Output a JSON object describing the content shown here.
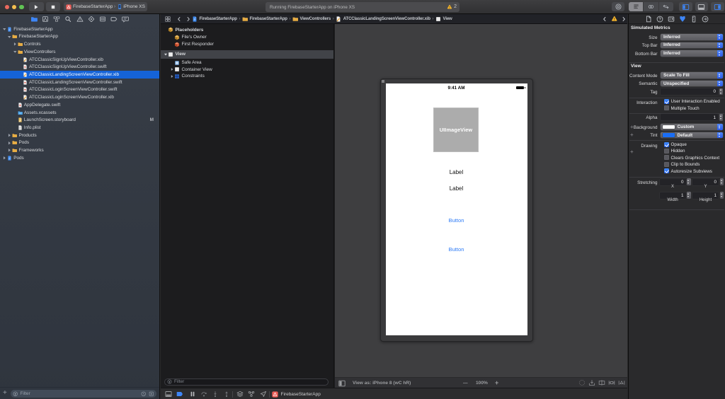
{
  "colors": {
    "accent_blue": "#1563d8",
    "checkbox_blue": "#2f6cf2",
    "folder_yellow": "#e0a63e",
    "warning_yellow": "#f5b52e",
    "button_blue": "#2e7bf6",
    "selected_text": "#ffffff"
  },
  "toolbar": {
    "window_buttons": [
      "close",
      "minimize",
      "zoom"
    ],
    "run_button": "run",
    "stop_button": "stop",
    "scheme": {
      "app_icon": "app-icon-red",
      "app": "FirebaseStarterApp",
      "chevron": "›",
      "device_icon": "iphone-icon",
      "device": "iPhone XS"
    },
    "activity": {
      "message": "Running FirebaseStarterApp on iPhone XS",
      "warning_icon": "warning-triangle-icon",
      "warning_count": "2"
    },
    "library_button": "library",
    "editor_modes": [
      "standard-editor",
      "assistant-editor",
      "version-editor"
    ],
    "panel_toggles": [
      "navigator-panel",
      "debug-panel",
      "inspector-panel"
    ]
  },
  "navigator": {
    "tabs": [
      "project-navigator",
      "source-control-navigator",
      "symbol-navigator",
      "find-navigator",
      "issue-navigator",
      "test-navigator",
      "debug-navigator",
      "breakpoint-navigator",
      "report-navigator"
    ],
    "selected_tab": 0,
    "tree": [
      {
        "label": "FirebaseStarterApp",
        "level": 0,
        "icon": "project",
        "disc": "open"
      },
      {
        "label": "FirebaseStarterApp",
        "level": 1,
        "icon": "folder",
        "disc": "open"
      },
      {
        "label": "Controls",
        "level": 2,
        "icon": "folder",
        "disc": "closed"
      },
      {
        "label": "ViewControllers",
        "level": 2,
        "icon": "folder",
        "disc": "open"
      },
      {
        "label": "ATCClassicSignUpViewController.xib",
        "level": 3,
        "icon": "xib"
      },
      {
        "label": "ATCClassicSignUpViewController.swift",
        "level": 3,
        "icon": "swift"
      },
      {
        "label": "ATCClassicLandingScreenViewController.xib",
        "level": 3,
        "icon": "xib",
        "selected": true
      },
      {
        "label": "ATCClassicLandingScreenViewController.swift",
        "level": 3,
        "icon": "swift"
      },
      {
        "label": "ATCClassicLoginScreenViewController.swift",
        "level": 3,
        "icon": "swift"
      },
      {
        "label": "ATCClassicLoginScreenViewController.xib",
        "level": 3,
        "icon": "xib"
      },
      {
        "label": "AppDelegate.swift",
        "level": 2,
        "icon": "swift"
      },
      {
        "label": "Assets.xcassets",
        "level": 2,
        "icon": "assets"
      },
      {
        "label": "LaunchScreen.storyboard",
        "level": 2,
        "icon": "storyboard",
        "badge": "M"
      },
      {
        "label": "Info.plist",
        "level": 2,
        "icon": "plist"
      },
      {
        "label": "Products",
        "level": 1,
        "icon": "folder",
        "disc": "closed"
      },
      {
        "label": "Pods",
        "level": 1,
        "icon": "folder",
        "disc": "closed"
      },
      {
        "label": "Frameworks",
        "level": 1,
        "icon": "folder",
        "disc": "closed"
      },
      {
        "label": "Pods",
        "level": 0,
        "icon": "project",
        "disc": "closed"
      }
    ],
    "filter": {
      "add_button": "+",
      "placeholder": "Filter",
      "recent_icon": "clock-icon",
      "scm_icon": "scm-filter-icon"
    }
  },
  "jumpbar": {
    "related_icon": "related-items-icon",
    "back_icon": "chevron-left",
    "forward_icon": "chevron-right",
    "crumbs": [
      {
        "label": "FirebaseStarterApp",
        "icon": "project"
      },
      {
        "label": "FirebaseStarterApp",
        "icon": "folder"
      },
      {
        "label": "ViewControllers",
        "icon": "folder"
      },
      {
        "label": "ATCClassicLandingScreenViewController.xib",
        "icon": "xib"
      },
      {
        "label": "View",
        "icon": "view-square"
      }
    ],
    "issues": {
      "prev": "chevron-left",
      "warning": "warning-triangle-icon",
      "next": "chevron-right"
    }
  },
  "outline": {
    "items": [
      {
        "label": "Placeholders",
        "icon": "cube-yellow",
        "bold": true,
        "indent": 0,
        "y": 3
      },
      {
        "label": "File's Owner",
        "icon": "cube-yellow",
        "indent": 1,
        "y": 13.6
      },
      {
        "label": "First Responder",
        "icon": "cube-red",
        "indent": 1,
        "y": 23.4
      },
      {
        "label": "View",
        "icon": "view-square",
        "bold": true,
        "indent": 0,
        "disc": "open",
        "highlight": true,
        "y": 36.5,
        "h": 12
      },
      {
        "label": "Safe Area",
        "icon": "safe-area",
        "indent": 1,
        "y": 49.3
      },
      {
        "label": "Container View",
        "icon": "view-square",
        "indent": 1,
        "disc": "closed",
        "y": 58.9
      },
      {
        "label": "Constraints",
        "icon": "constraints",
        "indent": 1,
        "disc": "closed",
        "y": 68.5
      }
    ],
    "filter_placeholder": "Filter"
  },
  "canvas": {
    "status_time": "9:41 AM",
    "imageview_label": "UIImageView",
    "labels": [
      "Label",
      "Label"
    ],
    "buttons": [
      "Button",
      "Button"
    ],
    "bottombar": {
      "outline_toggle": "document-outline-icon",
      "view_as": "View as: iPhone 8 (wC hR)",
      "zoom_out": "—",
      "zoom_level": "100%",
      "zoom_in": "+",
      "layout_buttons": [
        "update-frames",
        "embed-stack",
        "align",
        "pin",
        "resolve"
      ]
    }
  },
  "debugbar": {
    "toggle_icon": "debug-area-toggle",
    "breakpoints_icon": "breakpoints-tag",
    "controls": [
      "pause",
      "step-over",
      "step-into",
      "step-out"
    ],
    "tools": [
      "view-hierarchy",
      "memory-graph",
      "simulate-location"
    ],
    "process": {
      "icon": "app-icon-red",
      "name": "FirebaseStarterApp"
    }
  },
  "inspector": {
    "tabs": [
      "file-inspector",
      "quick-help-inspector",
      "identity-inspector",
      "attributes-inspector",
      "size-inspector",
      "connections-inspector"
    ],
    "selected_tab": 3,
    "sections": {
      "simulated_metrics": {
        "header": "Simulated Metrics",
        "rows": [
          {
            "label": "Size",
            "value": "Inferred"
          },
          {
            "label": "Top Bar",
            "value": "Inferred"
          },
          {
            "label": "Bottom Bar",
            "value": "Inferred"
          }
        ]
      },
      "view": {
        "header": "View",
        "content_mode": {
          "label": "Content Mode",
          "value": "Scale To Fill"
        },
        "semantic": {
          "label": "Semantic",
          "value": "Unspecified"
        },
        "tag": {
          "label": "Tag",
          "value": "0"
        },
        "interaction": {
          "label": "Interaction",
          "options": [
            {
              "label": "User Interaction Enabled",
              "checked": true
            },
            {
              "label": "Multiple Touch",
              "checked": false
            }
          ]
        },
        "alpha": {
          "label": "Alpha",
          "value": "1"
        },
        "background": {
          "label": "Background",
          "value": "Custom",
          "swatch": "#ffffff",
          "variation": "+"
        },
        "tint": {
          "label": "Tint",
          "value": "Default",
          "swatch": "#1a6ef5",
          "variation": "+"
        },
        "drawing": {
          "label": "Drawing",
          "options": [
            {
              "label": "Opaque",
              "checked": true
            },
            {
              "label": "Hidden",
              "checked": false,
              "variation": "+"
            },
            {
              "label": "Clears Graphics Context",
              "checked": false
            },
            {
              "label": "Clip to Bounds",
              "checked": false
            },
            {
              "label": "Autoresize Subviews",
              "checked": true
            }
          ]
        },
        "stretching": {
          "label": "Stretching",
          "fields": [
            {
              "label": "X",
              "value": "0"
            },
            {
              "label": "Y",
              "value": "0"
            },
            {
              "label": "Width",
              "value": "1"
            },
            {
              "label": "Height",
              "value": "1"
            }
          ]
        }
      }
    }
  }
}
